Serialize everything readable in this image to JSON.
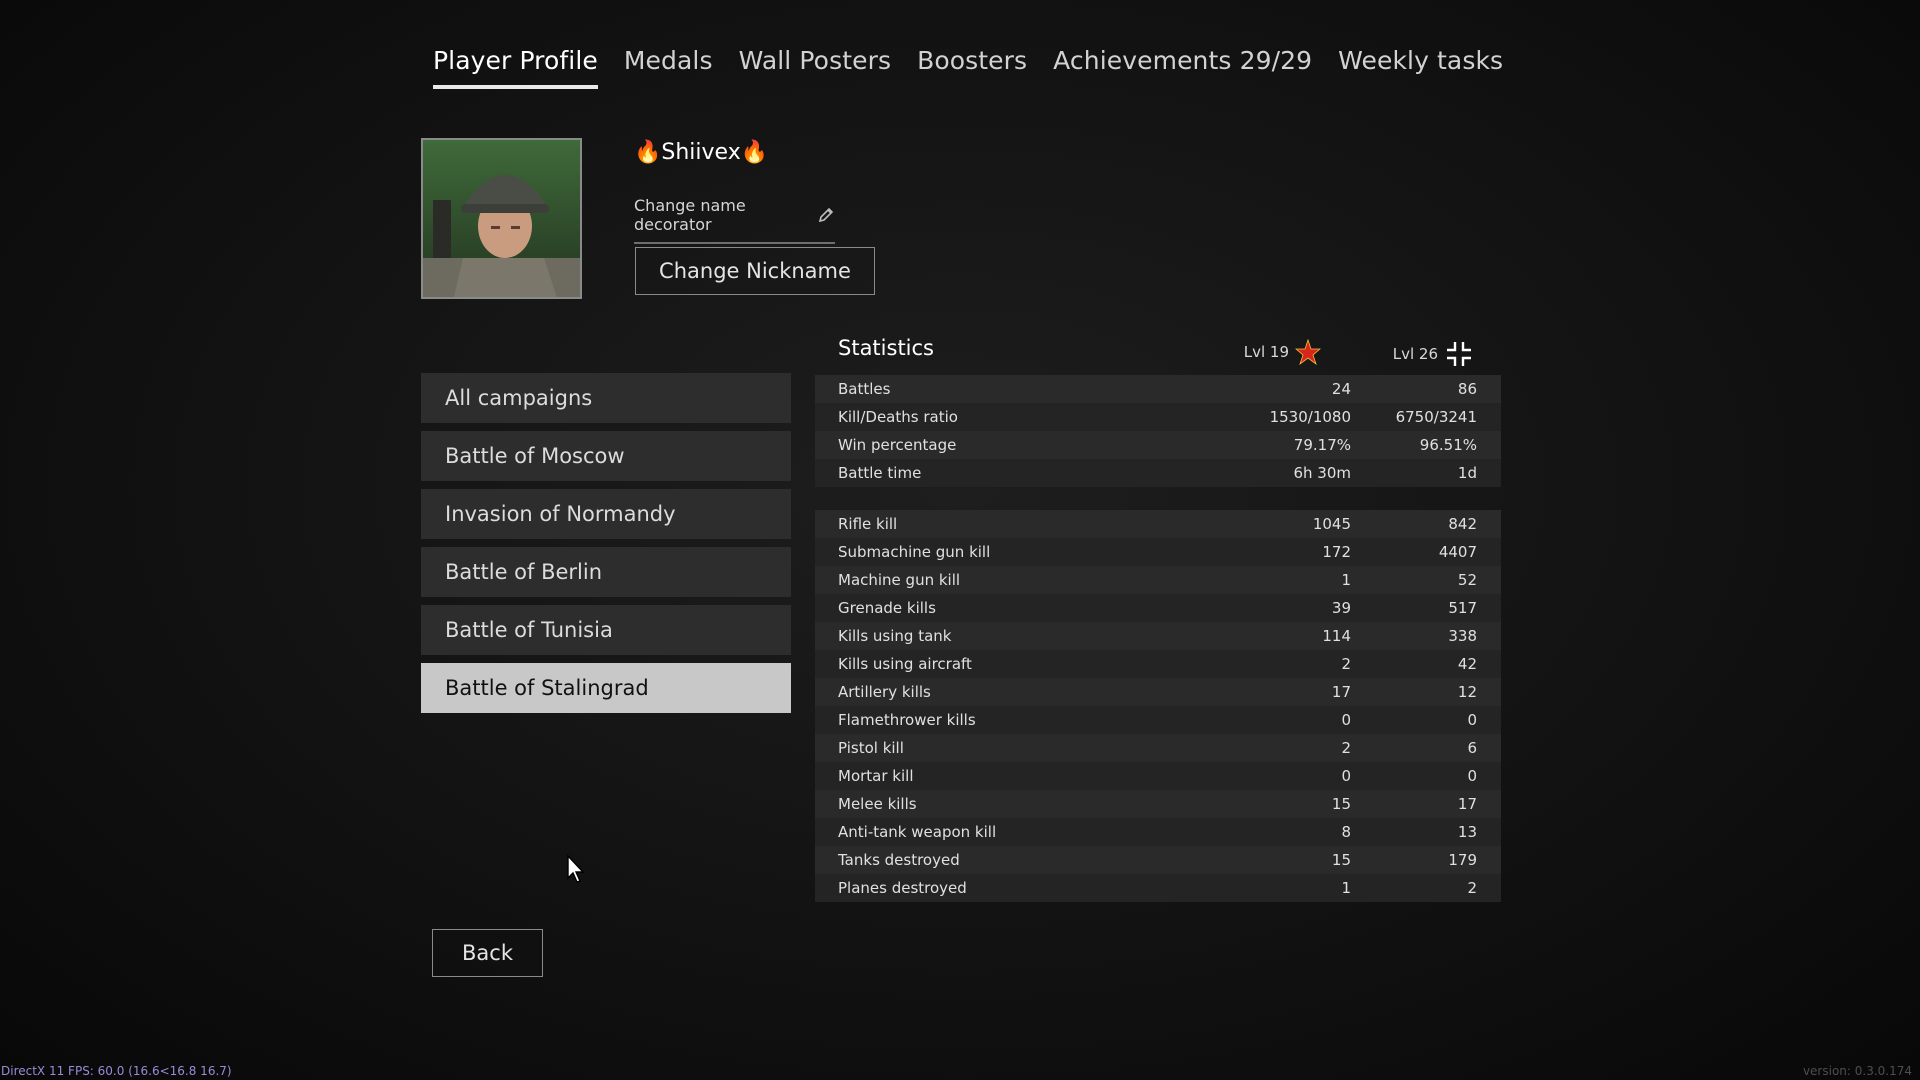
{
  "tabs": [
    {
      "label": "Player Profile",
      "active": true
    },
    {
      "label": "Medals"
    },
    {
      "label": "Wall Posters"
    },
    {
      "label": "Boosters"
    },
    {
      "label": "Achievements 29/29"
    },
    {
      "label": "Weekly tasks"
    }
  ],
  "profile": {
    "nickname": "🔥Shiivex🔥",
    "decorator_label": "Change name decorator",
    "change_nickname_label": "Change Nickname"
  },
  "campaigns": [
    {
      "label": "All campaigns"
    },
    {
      "label": "Battle of Moscow"
    },
    {
      "label": "Invasion of Normandy"
    },
    {
      "label": "Battle of Berlin"
    },
    {
      "label": "Battle of Tunisia"
    },
    {
      "label": "Battle of Stalingrad",
      "active": true
    }
  ],
  "stats": {
    "title": "Statistics",
    "col1_level": "Lvl 19",
    "col2_level": "Lvl 26",
    "col1_icon": "soviet-star-icon",
    "col2_icon": "balkenkreuz-icon",
    "general": [
      {
        "label": "Battles",
        "v1": "24",
        "v2": "86"
      },
      {
        "label": "Kill/Deaths ratio",
        "v1": "1530/1080",
        "v2": "6750/3241"
      },
      {
        "label": "Win percentage",
        "v1": "79.17%",
        "v2": "96.51%"
      },
      {
        "label": "Battle time",
        "v1": "6h 30m",
        "v2": "1d"
      }
    ],
    "kills": [
      {
        "label": "Rifle kill",
        "v1": "1045",
        "v2": "842"
      },
      {
        "label": "Submachine gun kill",
        "v1": "172",
        "v2": "4407"
      },
      {
        "label": "Machine gun kill",
        "v1": "1",
        "v2": "52"
      },
      {
        "label": "Grenade kills",
        "v1": "39",
        "v2": "517"
      },
      {
        "label": "Kills using tank",
        "v1": "114",
        "v2": "338"
      },
      {
        "label": "Kills using aircraft",
        "v1": "2",
        "v2": "42"
      },
      {
        "label": "Artillery kills",
        "v1": "17",
        "v2": "12"
      },
      {
        "label": "Flamethrower kills",
        "v1": "0",
        "v2": "0"
      },
      {
        "label": "Pistol kill",
        "v1": "2",
        "v2": "6"
      },
      {
        "label": "Mortar kill",
        "v1": "0",
        "v2": "0"
      },
      {
        "label": "Melee kills",
        "v1": "15",
        "v2": "17"
      },
      {
        "label": "Anti-tank weapon kill",
        "v1": "8",
        "v2": "13"
      },
      {
        "label": "Tanks destroyed",
        "v1": "15",
        "v2": "179"
      },
      {
        "label": "Planes destroyed",
        "v1": "1",
        "v2": "2"
      }
    ]
  },
  "back_label": "Back",
  "footer": {
    "fps": "DirectX 11 FPS: 60.0 (16.6<16.8 16.7)",
    "version": "version: 0.3.0.174"
  },
  "colors": {
    "accent_star": "#d8261c",
    "active_item_bg": "#c8c8c8"
  }
}
